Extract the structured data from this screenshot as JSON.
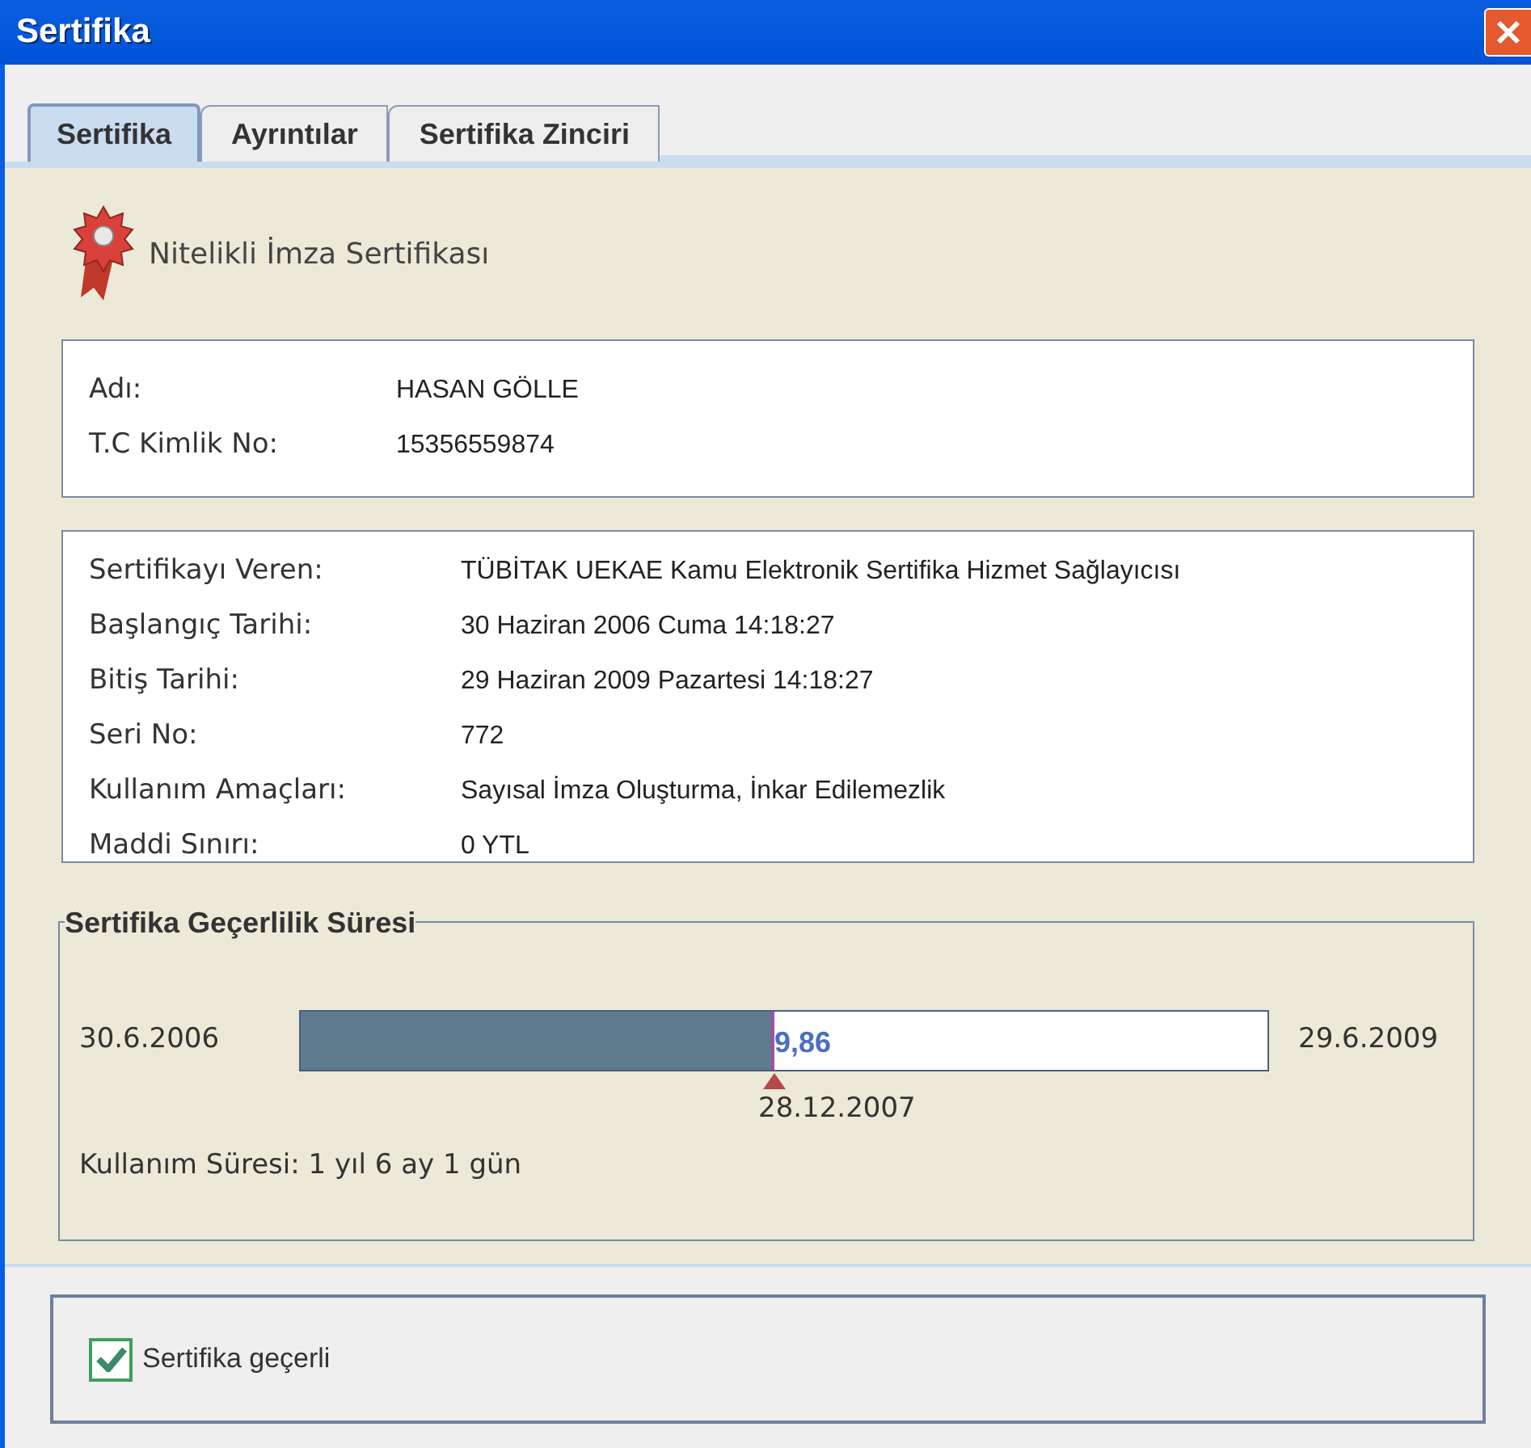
{
  "window": {
    "title": "Sertifika"
  },
  "tabs": [
    {
      "label": "Sertifika",
      "selected": true
    },
    {
      "label": "Ayrıntılar",
      "selected": false
    },
    {
      "label": "Sertifika Zinciri",
      "selected": false
    }
  ],
  "header": {
    "title": "Nitelikli İmza Sertifikası"
  },
  "holder": [
    {
      "label": "Adı:",
      "value": "HASAN GÖLLE"
    },
    {
      "label": "T.C Kimlik No:",
      "value": "15356559874"
    }
  ],
  "details": [
    {
      "label": "Sertifikayı Veren:",
      "value": "TÜBİTAK UEKAE Kamu Elektronik Sertifika Hizmet Sağlayıcısı"
    },
    {
      "label": "Başlangıç Tarihi:",
      "value": "30 Haziran 2006 Cuma 14:18:27"
    },
    {
      "label": "Bitiş Tarihi:",
      "value": "29 Haziran 2009 Pazartesi 14:18:27"
    },
    {
      "label": "Seri No:",
      "value": "772"
    },
    {
      "label": "Kullanım Amaçları:",
      "value": "Sayısal İmza Oluşturma, İnkar Edilemezlik"
    },
    {
      "label": "Maddi Sınırı:",
      "value": "0 YTL"
    }
  ],
  "validity": {
    "title": "Sertifika Geçerlilik Süresi",
    "start": "30.6.2006",
    "end": "29.6.2009",
    "level": 0.49,
    "bar_text": "9,86",
    "marker": "28.12.2007",
    "usage": "Kullanım Süresi: 1 yıl 6 ay 1 gün"
  },
  "status": {
    "label": "Sertifika geçerli",
    "checked": true
  }
}
